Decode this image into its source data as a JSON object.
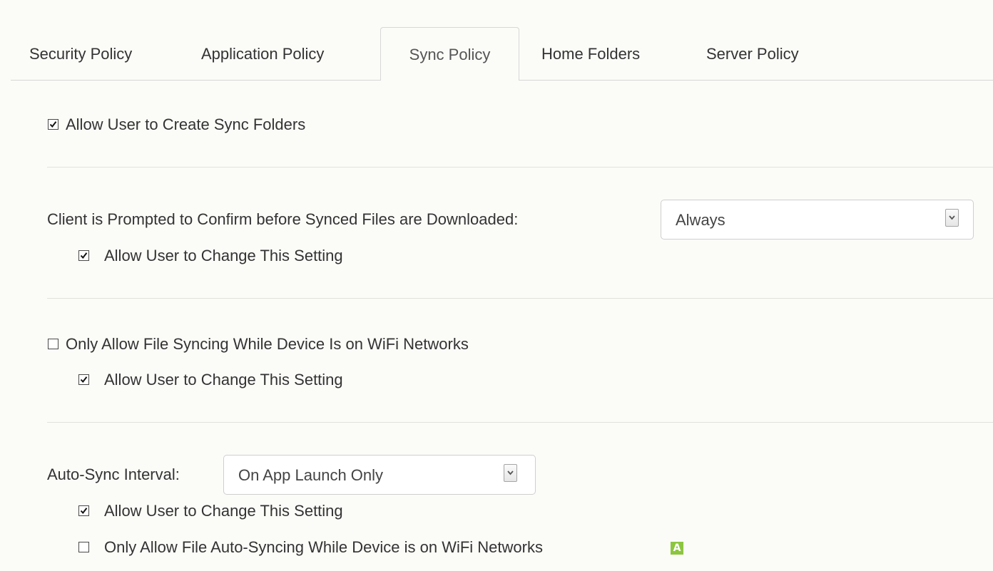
{
  "tabs": [
    {
      "label": "Security Policy",
      "active": false
    },
    {
      "label": "Application Policy",
      "active": false
    },
    {
      "label": "Sync Policy",
      "active": true
    },
    {
      "label": "Home Folders",
      "active": false
    },
    {
      "label": "Server Policy",
      "active": false
    }
  ],
  "sections": {
    "create_sync_folders": {
      "label": "Allow User to Create Sync Folders",
      "checked": true
    },
    "confirm_download": {
      "label": "Client is Prompted to Confirm before Synced Files are Downloaded:",
      "selected": "Always",
      "allow_change_label": "Allow User to Change This Setting",
      "allow_change_checked": true
    },
    "wifi_only": {
      "label": "Only Allow File Syncing While Device Is on WiFi Networks",
      "checked": false,
      "allow_change_label": "Allow User to Change This Setting",
      "allow_change_checked": true
    },
    "auto_sync": {
      "label": "Auto-Sync Interval:",
      "selected": "On App Launch Only",
      "allow_change_label": "Allow User to Change This Setting",
      "allow_change_checked": true,
      "wifi_auto_label": "Only Allow File Auto-Syncing While Device is on WiFi Networks",
      "wifi_auto_checked": false,
      "badge": "A"
    }
  },
  "icons": {
    "checkmark": "checkmark-icon",
    "dropdown": "chevron-down-icon"
  },
  "colors": {
    "background": "#fbfbf8",
    "badge": "#8cc63f",
    "text": "#333333"
  }
}
